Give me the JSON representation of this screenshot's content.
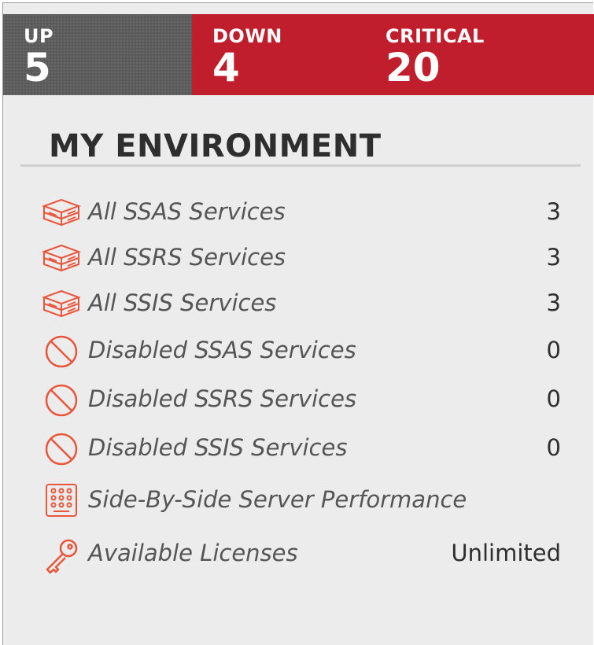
{
  "status": {
    "up": {
      "label": "UP",
      "value": "5"
    },
    "down": {
      "label": "DOWN",
      "value": "4"
    },
    "critical": {
      "label": "CRITICAL",
      "value": "20"
    },
    "colors": {
      "up_bg": "#5b5b5b",
      "alert_bg": "#c01e2c",
      "text": "#ffffff"
    }
  },
  "environment": {
    "title": "MY ENVIRONMENT",
    "accent_color": "#e8563c",
    "items": [
      {
        "icon": "server-icon",
        "label": "All SSAS Services",
        "count": "3"
      },
      {
        "icon": "server-icon",
        "label": "All SSRS Services",
        "count": "3"
      },
      {
        "icon": "server-icon",
        "label": "All SSIS Services",
        "count": "3"
      },
      {
        "icon": "disabled-icon",
        "label": "Disabled SSAS Services",
        "count": "0"
      },
      {
        "icon": "disabled-icon",
        "label": "Disabled SSRS Services",
        "count": "0"
      },
      {
        "icon": "disabled-icon",
        "label": "Disabled SSIS Services",
        "count": "0"
      },
      {
        "icon": "server-grid-icon",
        "label": "Side-By-Side Server Performance",
        "count": ""
      },
      {
        "icon": "key-icon",
        "label": "Available Licenses",
        "count": "Unlimited"
      }
    ]
  }
}
